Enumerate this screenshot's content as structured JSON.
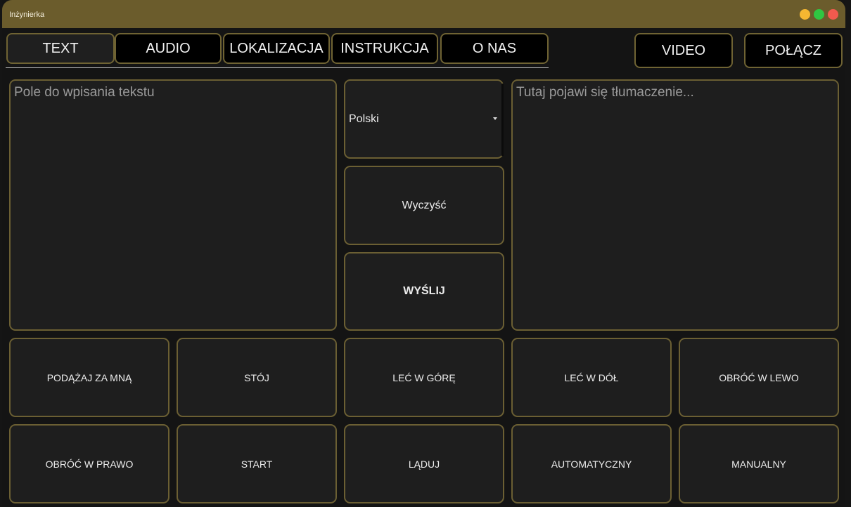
{
  "window": {
    "title": "Inżynierka"
  },
  "tabs": [
    {
      "label": "TEXT",
      "active": true
    },
    {
      "label": "AUDIO"
    },
    {
      "label": "LOKALIZACJA"
    },
    {
      "label": "INSTRUKCJA"
    },
    {
      "label": "O NAS"
    }
  ],
  "header_buttons": {
    "video": "VIDEO",
    "connect": "POŁĄCZ"
  },
  "input": {
    "placeholder": "Pole do wpisania tekstu",
    "value": ""
  },
  "output": {
    "placeholder": "Tutaj pojawi się tłumaczenie...",
    "value": ""
  },
  "language": {
    "selected": "Polski"
  },
  "actions": {
    "clear": "Wyczyść",
    "send": "WYŚLIJ"
  },
  "commands": [
    "PODĄŻAJ ZA MNĄ",
    "STÓJ",
    "LEĆ W GÓRĘ",
    "LEĆ W DÓŁ",
    "OBRÓĆ W LEWO",
    "OBRÓĆ W PRAWO",
    "START",
    "LĄDUJ",
    "AUTOMATYCZNY",
    "MANUALNY"
  ],
  "colors": {
    "titlebar": "#6b5c2c",
    "border": "#6b5f33",
    "panel": "#1e1e1e"
  }
}
